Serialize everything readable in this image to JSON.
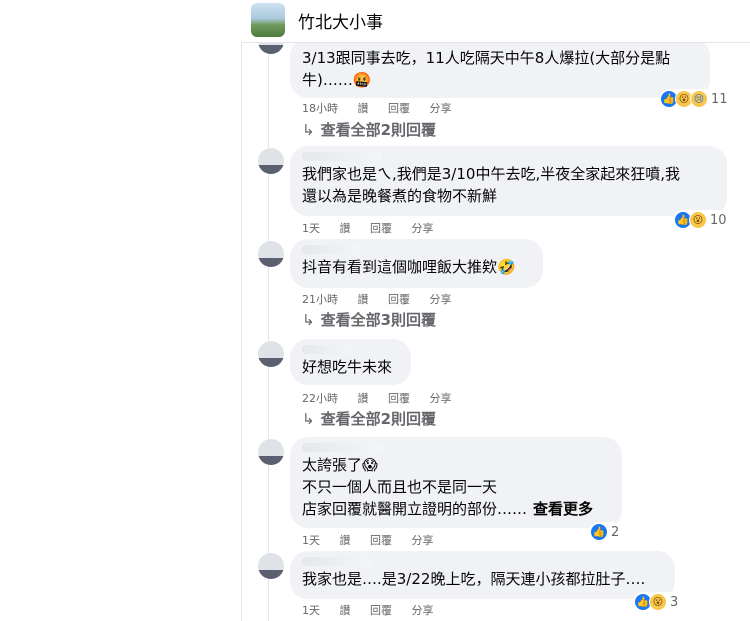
{
  "header": {
    "title": "竹北大小事"
  },
  "actions": {
    "like": "讚",
    "reply": "回覆",
    "share": "分享"
  },
  "comments": [
    {
      "text_line1": "3/13跟同事去吃，11人吃隔天中午8人爆拉(大部分是點",
      "text_line2": "牛)……🤬",
      "time": "18小時",
      "reaction_count": "11",
      "view_replies": "查看全部2則回覆"
    },
    {
      "text_line1": "我們家也是ㄟ,我們是3/10中午去吃,半夜全家起來狂噴,我",
      "text_line2": "還以為是晚餐煮的食物不新鮮",
      "time": "1天",
      "reaction_count": "10"
    },
    {
      "text_line1": "抖音有看到這個咖哩飯大推欸🤣",
      "time": "21小時",
      "view_replies": "查看全部3則回覆"
    },
    {
      "text_line1": "好想吃牛未來",
      "time": "22小時",
      "view_replies": "查看全部2則回覆"
    },
    {
      "text_line1": "太誇張了😱",
      "text_line2": "不只一個人而且也不是同一天",
      "text_line3": "店家回覆就醫開立證明的部份……",
      "see_more": "查看更多",
      "time": "1天",
      "reaction_count": "2"
    },
    {
      "text_line1": "我家也是….是3/22晚上吃，隔天連小孩都拉肚子….",
      "time": "1天",
      "reaction_count": "3"
    }
  ],
  "icons": {
    "like": "thumbs-up-icon",
    "wow": "wow-face-icon",
    "sad": "sad-face-icon",
    "reply_arrow": "reply-arrow-icon"
  },
  "colors": {
    "bubble": "#f0f2f5",
    "meta": "#65676b",
    "like": "#1877f2"
  }
}
